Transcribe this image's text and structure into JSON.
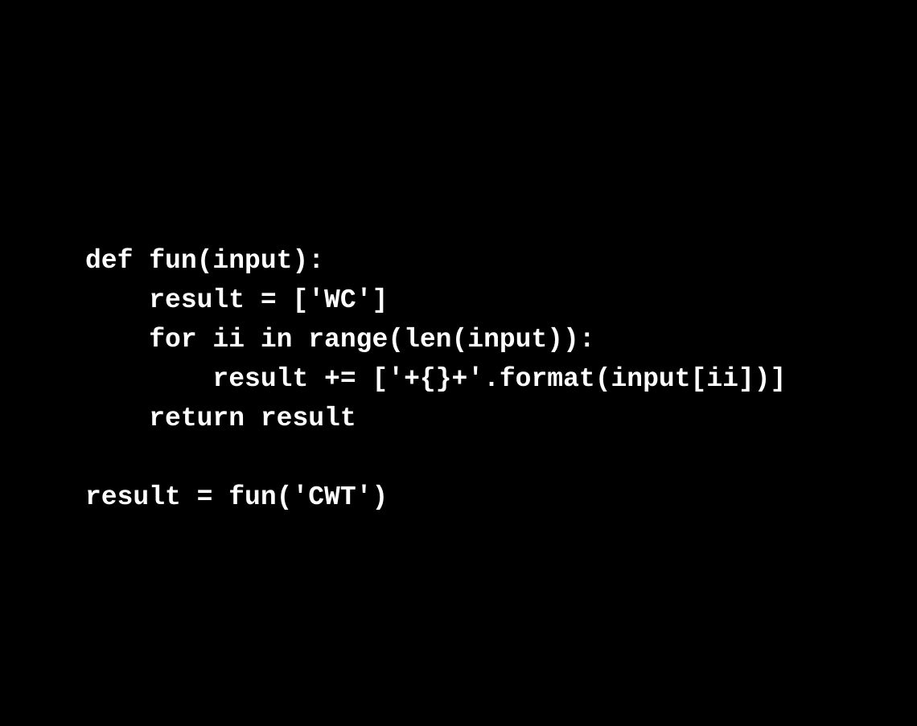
{
  "colors": {
    "background": "#000000",
    "text": "#ffffff"
  },
  "code": {
    "lines": [
      "def fun(input):",
      "    result = ['WC']",
      "    for ii in range(len(input)):",
      "        result += ['+{}+'.format(input[ii])]",
      "    return result",
      "",
      "result = fun('CWT')"
    ]
  }
}
